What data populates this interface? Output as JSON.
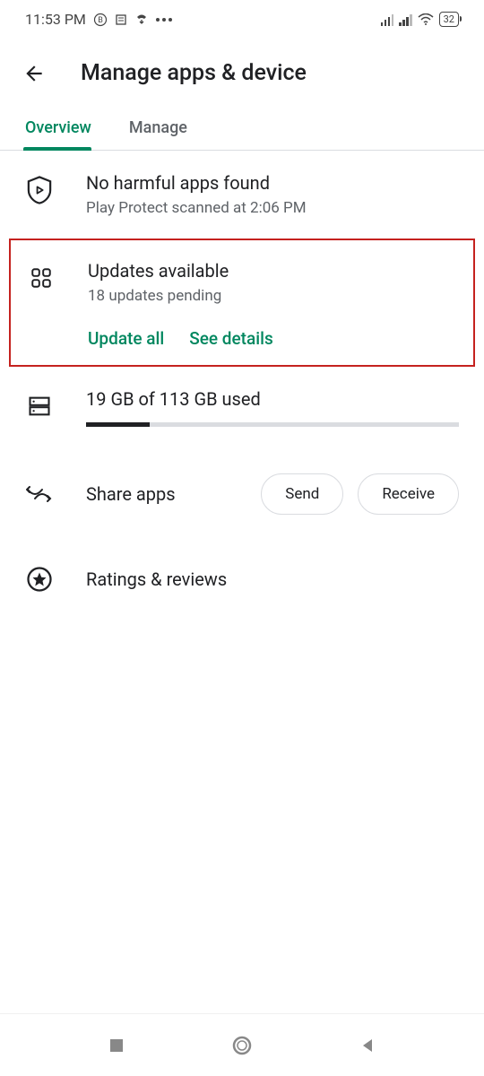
{
  "status_bar": {
    "time": "11:53 PM",
    "battery": "32"
  },
  "header": {
    "title": "Manage apps & device"
  },
  "tabs": {
    "overview": "Overview",
    "manage": "Manage"
  },
  "protect": {
    "title": "No harmful apps found",
    "subtitle": "Play Protect scanned at 2:06 PM"
  },
  "updates": {
    "title": "Updates available",
    "subtitle": "18 updates pending",
    "update_all": "Update all",
    "see_details": "See details"
  },
  "storage": {
    "title": "19 GB of 113 GB used",
    "percent": 17
  },
  "share": {
    "title": "Share apps",
    "send": "Send",
    "receive": "Receive"
  },
  "ratings": {
    "title": "Ratings & reviews"
  }
}
